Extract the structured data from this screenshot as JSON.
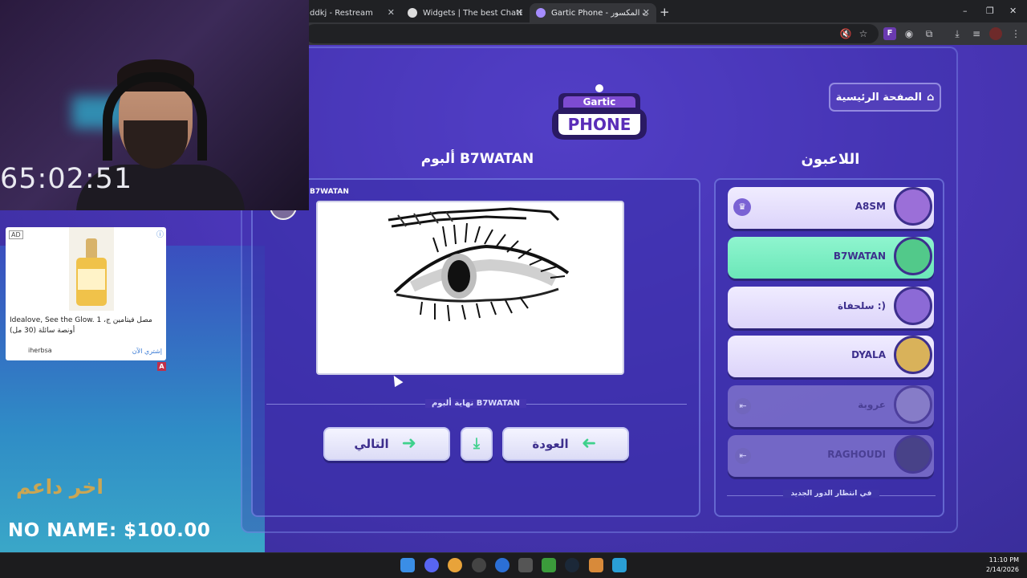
{
  "browser": {
    "tabs": [
      {
        "title": "ddkj - Restream",
        "color": "#e8eaed"
      },
      {
        "title": "Widgets | The best ChatBot and",
        "color": "#e8eaed"
      },
      {
        "title": "Gartic Phone - الهاتف المكسور",
        "color": "#a58cff"
      }
    ],
    "new_tab": "+",
    "window_controls": [
      "–",
      "❐",
      "✕"
    ]
  },
  "game": {
    "logo_top": "Gartic",
    "logo_bottom": "PHONE",
    "home_button": "الصفحة الرئيسية",
    "players_title": "اللاعبون",
    "album_title": "ألبوم B7WATAN",
    "drawing_author": "B7WATAN",
    "end_of_album": "نهاية ألبوم B7WATAN",
    "next_button": "التالي",
    "back_button": "العودة",
    "waiting_text": "في انتظار الدور الجديد",
    "players": [
      {
        "name": "A8SM",
        "state": "host",
        "avatar_color": "#9b6fd8"
      },
      {
        "name": "B7WATAN",
        "state": "active",
        "avatar_color": "#52c98a"
      },
      {
        "name": "سلحفاة :)",
        "state": "normal",
        "avatar_color": "#8c6ad6"
      },
      {
        "name": "DYALA",
        "state": "normal",
        "avatar_color": "#d9b25a"
      },
      {
        "name": "عروبة",
        "state": "left",
        "avatar_color": "#8f86c9"
      },
      {
        "name": "RAGHOUDI",
        "state": "left",
        "avatar_color": "#3e3a7a"
      }
    ],
    "colors": {
      "accent": "#4a36b8",
      "active": "#7ceec4",
      "button_text": "#3d2f8d"
    }
  },
  "stream": {
    "timer": "65:02:51",
    "donor_title": "اخر داعم",
    "donor": "NO NAME: $100.00",
    "ad": {
      "badge": "AD",
      "brand": "IDEALOVE",
      "text": "Idealove, See the Glow. 1 مصل فيتامين ج، أونصة سائلة (30 مل)",
      "source": "iherbsa",
      "cta": "إشتري الآن"
    }
  },
  "taskbar": {
    "time": "11:10 PM",
    "date": "2/14/2026"
  }
}
